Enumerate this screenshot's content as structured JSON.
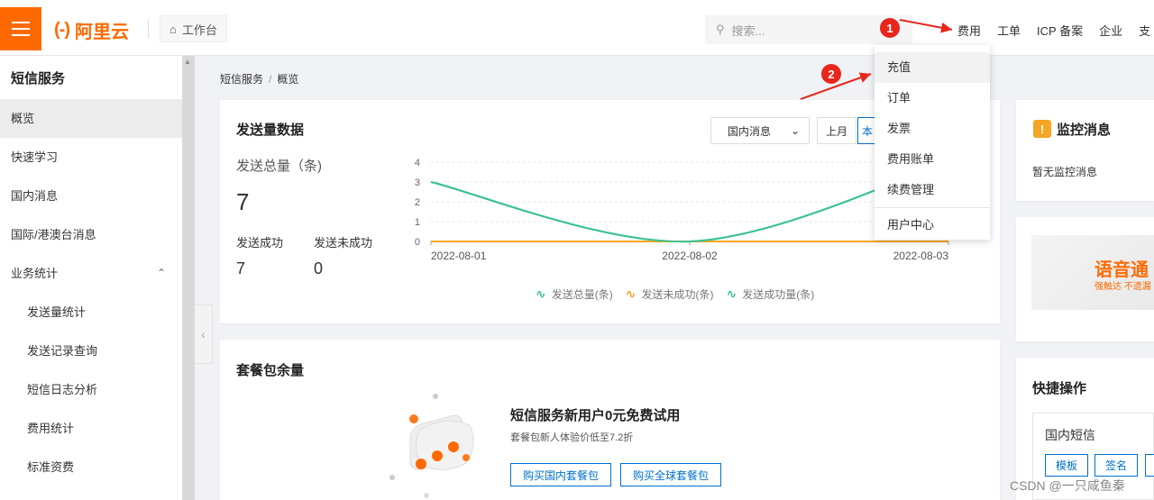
{
  "header": {
    "brand": "阿里云",
    "brand_mark": "(-)",
    "workbench": "工作台",
    "search_placeholder": "搜索...",
    "nav": [
      "费用",
      "工单",
      "ICP 备案",
      "企业",
      "支"
    ]
  },
  "annotations": {
    "marker1": "1",
    "marker2": "2",
    "color": "#e8261c"
  },
  "sidebar": {
    "title": "短信服务",
    "items": [
      {
        "label": "概览"
      },
      {
        "label": "快速学习"
      },
      {
        "label": "国内消息"
      },
      {
        "label": "国际/港澳台消息"
      },
      {
        "label": "业务统计"
      },
      {
        "label": "发送量统计"
      },
      {
        "label": "发送记录查询"
      },
      {
        "label": "短信日志分析"
      },
      {
        "label": "费用统计"
      },
      {
        "label": "标准资费"
      }
    ]
  },
  "breadcrumb": {
    "root": "短信服务",
    "sep": "/",
    "current": "概览"
  },
  "send_card": {
    "title": "发送量数据",
    "total_label": "发送总量（条)",
    "total_value": "7",
    "success_label": "发送成功",
    "success_value": "7",
    "fail_label": "发送未成功",
    "fail_value": "0",
    "select_value": "国内消息",
    "btn_last_month": "上月",
    "btn_this_month": "本"
  },
  "chart_data": {
    "type": "line",
    "x": [
      "2022-08-01",
      "2022-08-02",
      "2022-08-03"
    ],
    "ylim": [
      0,
      4
    ],
    "yticks": [
      0,
      1,
      2,
      3,
      4
    ],
    "series": [
      {
        "name": "发送总量(条)",
        "values": [
          3,
          0,
          4
        ],
        "color": "#3ec28f"
      },
      {
        "name": "发送未成功(条)",
        "values": [
          0,
          0,
          0
        ],
        "color": "#f5a623"
      },
      {
        "name": "发送成功量(条)",
        "values": [
          3,
          0,
          4
        ],
        "color": "#3ec28f"
      }
    ]
  },
  "package_card": {
    "title": "套餐包余量",
    "promo_title": "短信服务新用户0元免费试用",
    "promo_sub": "套餐包新人体验价低至7.2折",
    "btn_domestic": "购买国内套餐包",
    "btn_global": "购买全球套餐包"
  },
  "dropdown": {
    "items": [
      "充值",
      "订单",
      "发票",
      "费用账单",
      "续费管理",
      "用户中心"
    ]
  },
  "monitor": {
    "title": "监控消息",
    "empty": "暂无监控消息"
  },
  "banner": {
    "title": "语音通",
    "sub": "强触达 不遗漏"
  },
  "quick": {
    "title": "快捷操作",
    "label": "国内短信",
    "btn_template": "模板",
    "btn_sign": "签名"
  },
  "watermark": "CSDN @一只咸鱼秦"
}
